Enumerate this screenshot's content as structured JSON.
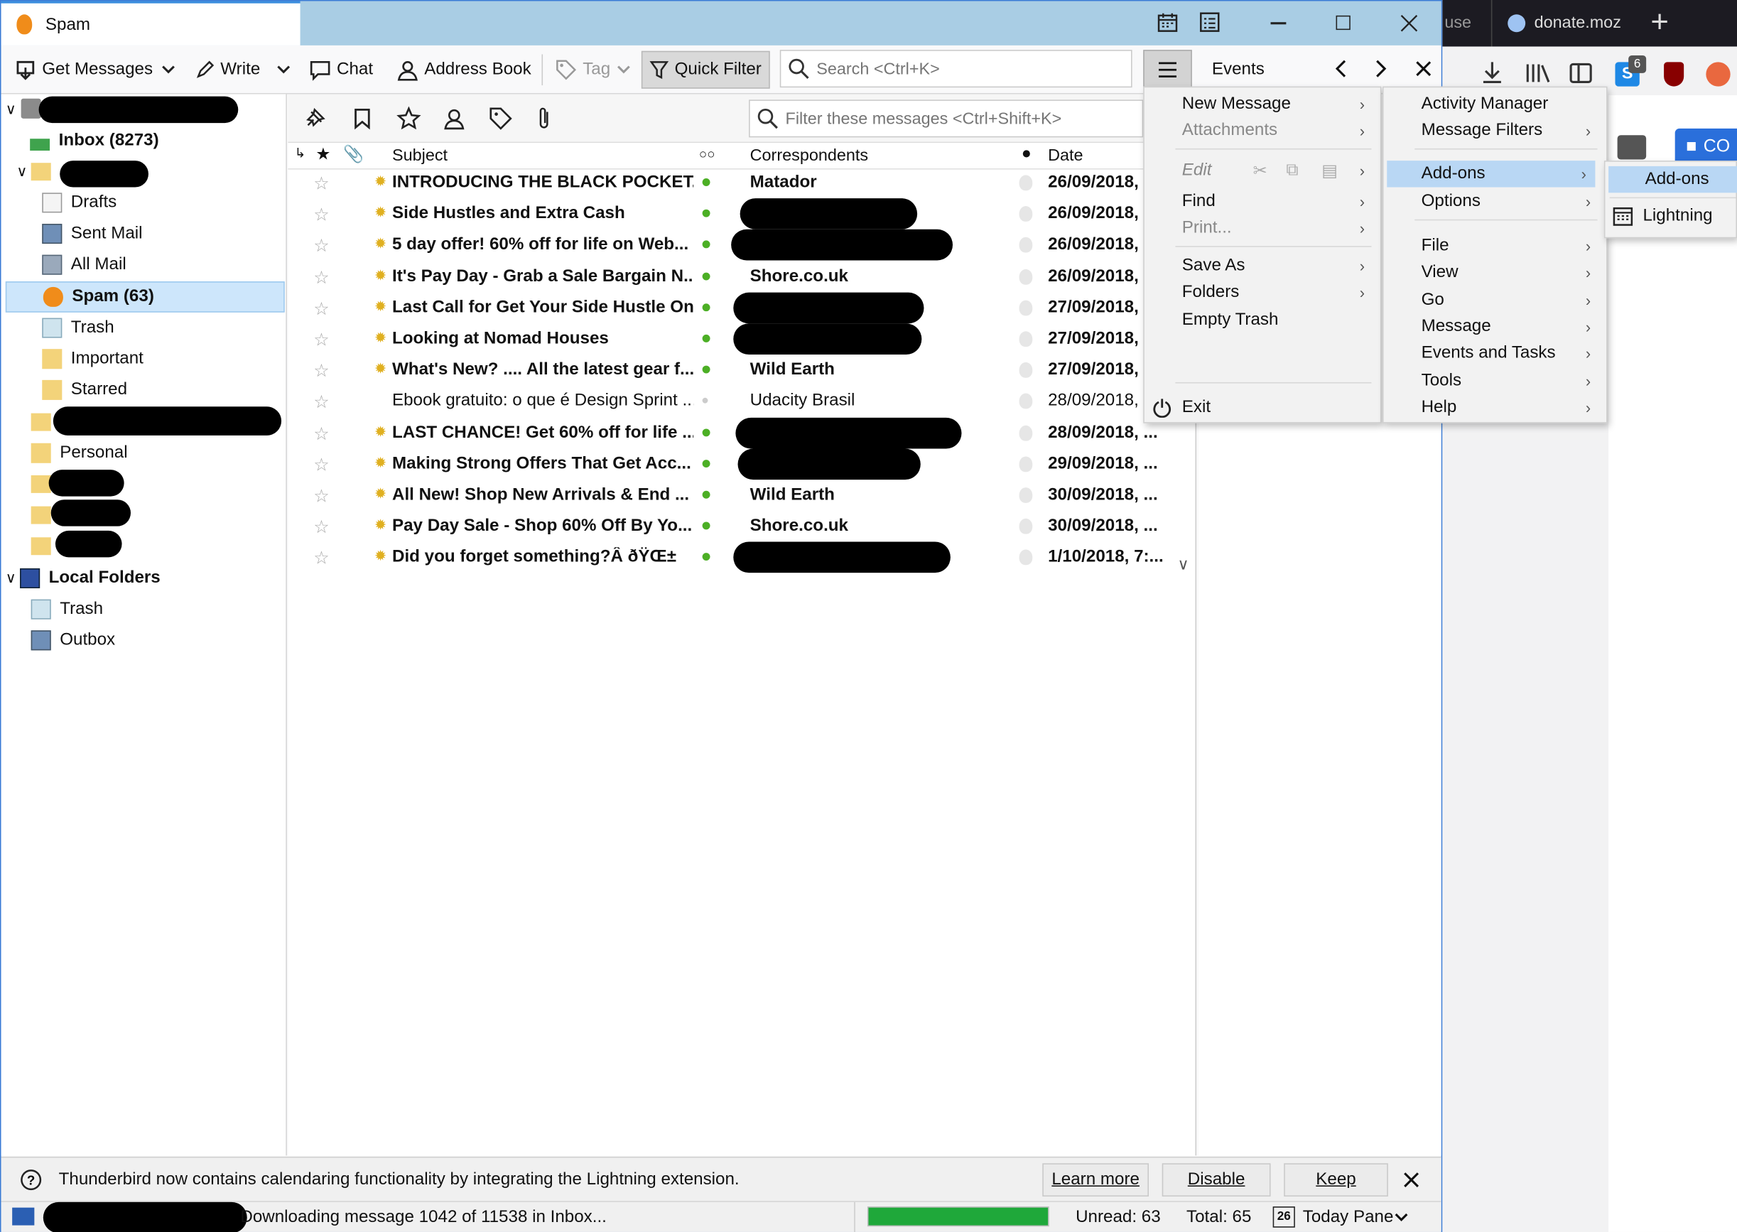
{
  "window": {
    "title": "Spam"
  },
  "toolbar": {
    "get_messages": "Get Messages",
    "write": "Write",
    "chat": "Chat",
    "address_book": "Address Book",
    "tag": "Tag",
    "quick_filter": "Quick Filter",
    "search_placeholder": "Search <Ctrl+K>",
    "events_label": "Events"
  },
  "folders": {
    "inbox": "Inbox (8273)",
    "drafts": "Drafts",
    "sent": "Sent Mail",
    "all": "All Mail",
    "spam": "Spam (63)",
    "trash": "Trash",
    "important": "Important",
    "starred": "Starred",
    "personal": "Personal",
    "local": "Local Folders",
    "local_trash": "Trash",
    "outbox": "Outbox"
  },
  "quick_filter": {
    "filter_placeholder": "Filter these messages <Ctrl+Shift+K>"
  },
  "columns": {
    "subject": "Subject",
    "correspondents": "Correspondents",
    "date": "Date"
  },
  "messages": [
    {
      "subject": "INTRODUCING THE BLACK POCKET...",
      "correspondent": "Matador",
      "date": "26/09/2018,"
    },
    {
      "subject": "Side Hustles and Extra Cash",
      "correspondent": "",
      "date": "26/09/2018,"
    },
    {
      "subject": "5 day offer! 60% off for life on Web...",
      "correspondent": "",
      "date": "26/09/2018,"
    },
    {
      "subject": "It's Pay Day - Grab a Sale Bargain N...",
      "correspondent": "Shore.co.uk",
      "date": "26/09/2018,"
    },
    {
      "subject": "Last Call for Get Your Side Hustle On",
      "correspondent": "",
      "date": "27/09/2018,"
    },
    {
      "subject": "Looking at Nomad Houses",
      "correspondent": "",
      "date": "27/09/2018,"
    },
    {
      "subject": "What's New? .... All the latest gear f...",
      "correspondent": "Wild Earth",
      "date": "27/09/2018,"
    },
    {
      "subject": "Ebook gratuito: o que é Design Sprint ...",
      "correspondent": "Udacity Brasil",
      "date": "28/09/2018,"
    },
    {
      "subject": "LAST CHANCE! Get 60% off for life ...",
      "correspondent": "",
      "date": "28/09/2018, ..."
    },
    {
      "subject": "Making Strong Offers That Get Acc...",
      "correspondent": "",
      "date": "29/09/2018, ..."
    },
    {
      "subject": "All New! Shop New Arrivals & End ...",
      "correspondent": "Wild Earth",
      "date": "30/09/2018, ..."
    },
    {
      "subject": "Pay Day Sale - Shop 60% Off By Yo...",
      "correspondent": "Shore.co.uk",
      "date": "30/09/2018, ..."
    },
    {
      "subject": "Did you forget something?Â ðŸŒ±",
      "correspondent": "",
      "date": "1/10/2018, 7:..."
    }
  ],
  "menu_main": {
    "new_message": "New Message",
    "attachments": "Attachments",
    "edit": "Edit",
    "find": "Find",
    "print": "Print...",
    "save_as": "Save As",
    "folders": "Folders",
    "empty_trash": "Empty Trash",
    "exit": "Exit"
  },
  "menu_right": {
    "activity_manager": "Activity Manager",
    "message_filters": "Message Filters",
    "addons": "Add-ons",
    "options": "Options",
    "file": "File",
    "view": "View",
    "go": "Go",
    "message": "Message",
    "events_tasks": "Events and Tasks",
    "tools": "Tools",
    "help": "Help"
  },
  "menu_addons": {
    "addons": "Add-ons",
    "lightning": "Lightning"
  },
  "notification": {
    "text": "Thunderbird now contains calendaring functionality by integrating the Lightning extension.",
    "learn_more": "Learn more",
    "disable": "Disable",
    "keep": "Keep"
  },
  "status": {
    "text": "Downloading message 1042 of 11538 in Inbox...",
    "progress": 1.0,
    "unread": "Unread: 63",
    "total": "Total: 65",
    "today_pane": "Today Pane",
    "today_day": "26"
  },
  "firefox": {
    "tab_partial": "use",
    "tab_donate": "donate.moz",
    "badge": "6",
    "btn_partial": "CO"
  },
  "colors": {
    "accent": "#3a8dde",
    "highlight": "#b9d7f4",
    "progress": "#1fa83a",
    "titlebar": "#a9cde4"
  }
}
